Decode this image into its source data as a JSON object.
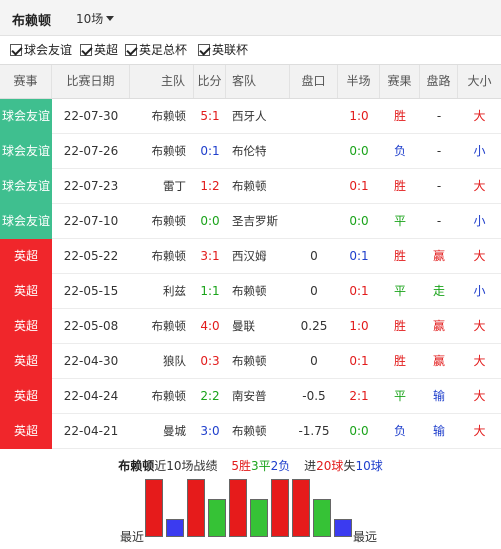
{
  "header": {
    "team": "布赖顿",
    "count_select": "10场"
  },
  "filters": [
    {
      "label": "球会友谊",
      "checked": true
    },
    {
      "label": "英超",
      "checked": true
    },
    {
      "label": "英足总杯",
      "checked": true
    },
    {
      "label": "英联杯",
      "checked": true
    }
  ],
  "columns": [
    "赛事",
    "比赛日期",
    "主队",
    "比分",
    "客队",
    "盘口",
    "半场",
    "赛果",
    "盘路",
    "大小"
  ],
  "rows": [
    {
      "league": "球会友谊",
      "league_color": "#3fbf8f",
      "date": "22-07-30",
      "home": "布赖顿",
      "score": "5:1",
      "score_color": "red",
      "away": "西牙人",
      "handicap": "",
      "half": "1:0",
      "half_color": "red",
      "result": "胜",
      "result_color": "red",
      "pan": "-",
      "pan_color": "dark",
      "ou": "大",
      "ou_color": "red"
    },
    {
      "league": "球会友谊",
      "league_color": "#3fbf8f",
      "date": "22-07-26",
      "home": "布赖顿",
      "score": "0:1",
      "score_color": "blue",
      "away": "布伦特",
      "handicap": "",
      "half": "0:0",
      "half_color": "green",
      "result": "负",
      "result_color": "blue",
      "pan": "-",
      "pan_color": "dark",
      "ou": "小",
      "ou_color": "blue"
    },
    {
      "league": "球会友谊",
      "league_color": "#3fbf8f",
      "date": "22-07-23",
      "home": "雷丁",
      "score": "1:2",
      "score_color": "red",
      "away": "布赖顿",
      "handicap": "",
      "half": "0:1",
      "half_color": "red",
      "result": "胜",
      "result_color": "red",
      "pan": "-",
      "pan_color": "dark",
      "ou": "大",
      "ou_color": "red"
    },
    {
      "league": "球会友谊",
      "league_color": "#3fbf8f",
      "date": "22-07-10",
      "home": "布赖顿",
      "score": "0:0",
      "score_color": "green",
      "away": "圣吉罗斯",
      "handicap": "",
      "half": "0:0",
      "half_color": "green",
      "result": "平",
      "result_color": "green",
      "pan": "-",
      "pan_color": "dark",
      "ou": "小",
      "ou_color": "blue"
    },
    {
      "league": "英超",
      "league_color": "#f0262b",
      "date": "22-05-22",
      "home": "布赖顿",
      "score": "3:1",
      "score_color": "red",
      "away": "西汉姆",
      "handicap": "0",
      "half": "0:1",
      "half_color": "blue",
      "result": "胜",
      "result_color": "red",
      "pan": "赢",
      "pan_color": "red",
      "ou": "大",
      "ou_color": "red"
    },
    {
      "league": "英超",
      "league_color": "#f0262b",
      "date": "22-05-15",
      "home": "利兹",
      "score": "1:1",
      "score_color": "green",
      "away": "布赖顿",
      "handicap": "0",
      "half": "0:1",
      "half_color": "red",
      "result": "平",
      "result_color": "green",
      "pan": "走",
      "pan_color": "green",
      "ou": "小",
      "ou_color": "blue"
    },
    {
      "league": "英超",
      "league_color": "#f0262b",
      "date": "22-05-08",
      "home": "布赖顿",
      "score": "4:0",
      "score_color": "red",
      "away": "曼联",
      "handicap": "0.25",
      "half": "1:0",
      "half_color": "red",
      "result": "胜",
      "result_color": "red",
      "pan": "赢",
      "pan_color": "red",
      "ou": "大",
      "ou_color": "red"
    },
    {
      "league": "英超",
      "league_color": "#f0262b",
      "date": "22-04-30",
      "home": "狼队",
      "score": "0:3",
      "score_color": "red",
      "away": "布赖顿",
      "handicap": "0",
      "half": "0:1",
      "half_color": "red",
      "result": "胜",
      "result_color": "red",
      "pan": "赢",
      "pan_color": "red",
      "ou": "大",
      "ou_color": "red"
    },
    {
      "league": "英超",
      "league_color": "#f0262b",
      "date": "22-04-24",
      "home": "布赖顿",
      "score": "2:2",
      "score_color": "green",
      "away": "南安普",
      "handicap": "-0.5",
      "half": "2:1",
      "half_color": "red",
      "result": "平",
      "result_color": "green",
      "pan": "输",
      "pan_color": "blue",
      "ou": "大",
      "ou_color": "red"
    },
    {
      "league": "英超",
      "league_color": "#f0262b",
      "date": "22-04-21",
      "home": "曼城",
      "score": "3:0",
      "score_color": "blue",
      "away": "布赖顿",
      "handicap": "-1.75",
      "half": "0:0",
      "half_color": "green",
      "result": "负",
      "result_color": "blue",
      "pan": "输",
      "pan_color": "blue",
      "ou": "大",
      "ou_color": "red"
    }
  ],
  "summary": {
    "team": "布赖顿",
    "label": "近10场战绩",
    "wins": "5胜",
    "draws": "3平",
    "losses": "2负",
    "goals_for_prefix": "进",
    "goals_for": "20球",
    "goals_against_prefix": "失",
    "goals_against": "10球"
  },
  "bars": {
    "left_label": "最近",
    "right_label": "最远",
    "sequence": [
      "win",
      "loss",
      "win",
      "draw",
      "win",
      "draw",
      "win",
      "win",
      "draw",
      "loss"
    ],
    "colors": {
      "win": "#e61b1b",
      "draw": "#36c236",
      "loss": "#3b3bf0"
    }
  },
  "colors": {
    "red": "#e21b1b",
    "green": "#1aa31a",
    "blue": "#1f3fcc",
    "dark": "#333333"
  }
}
